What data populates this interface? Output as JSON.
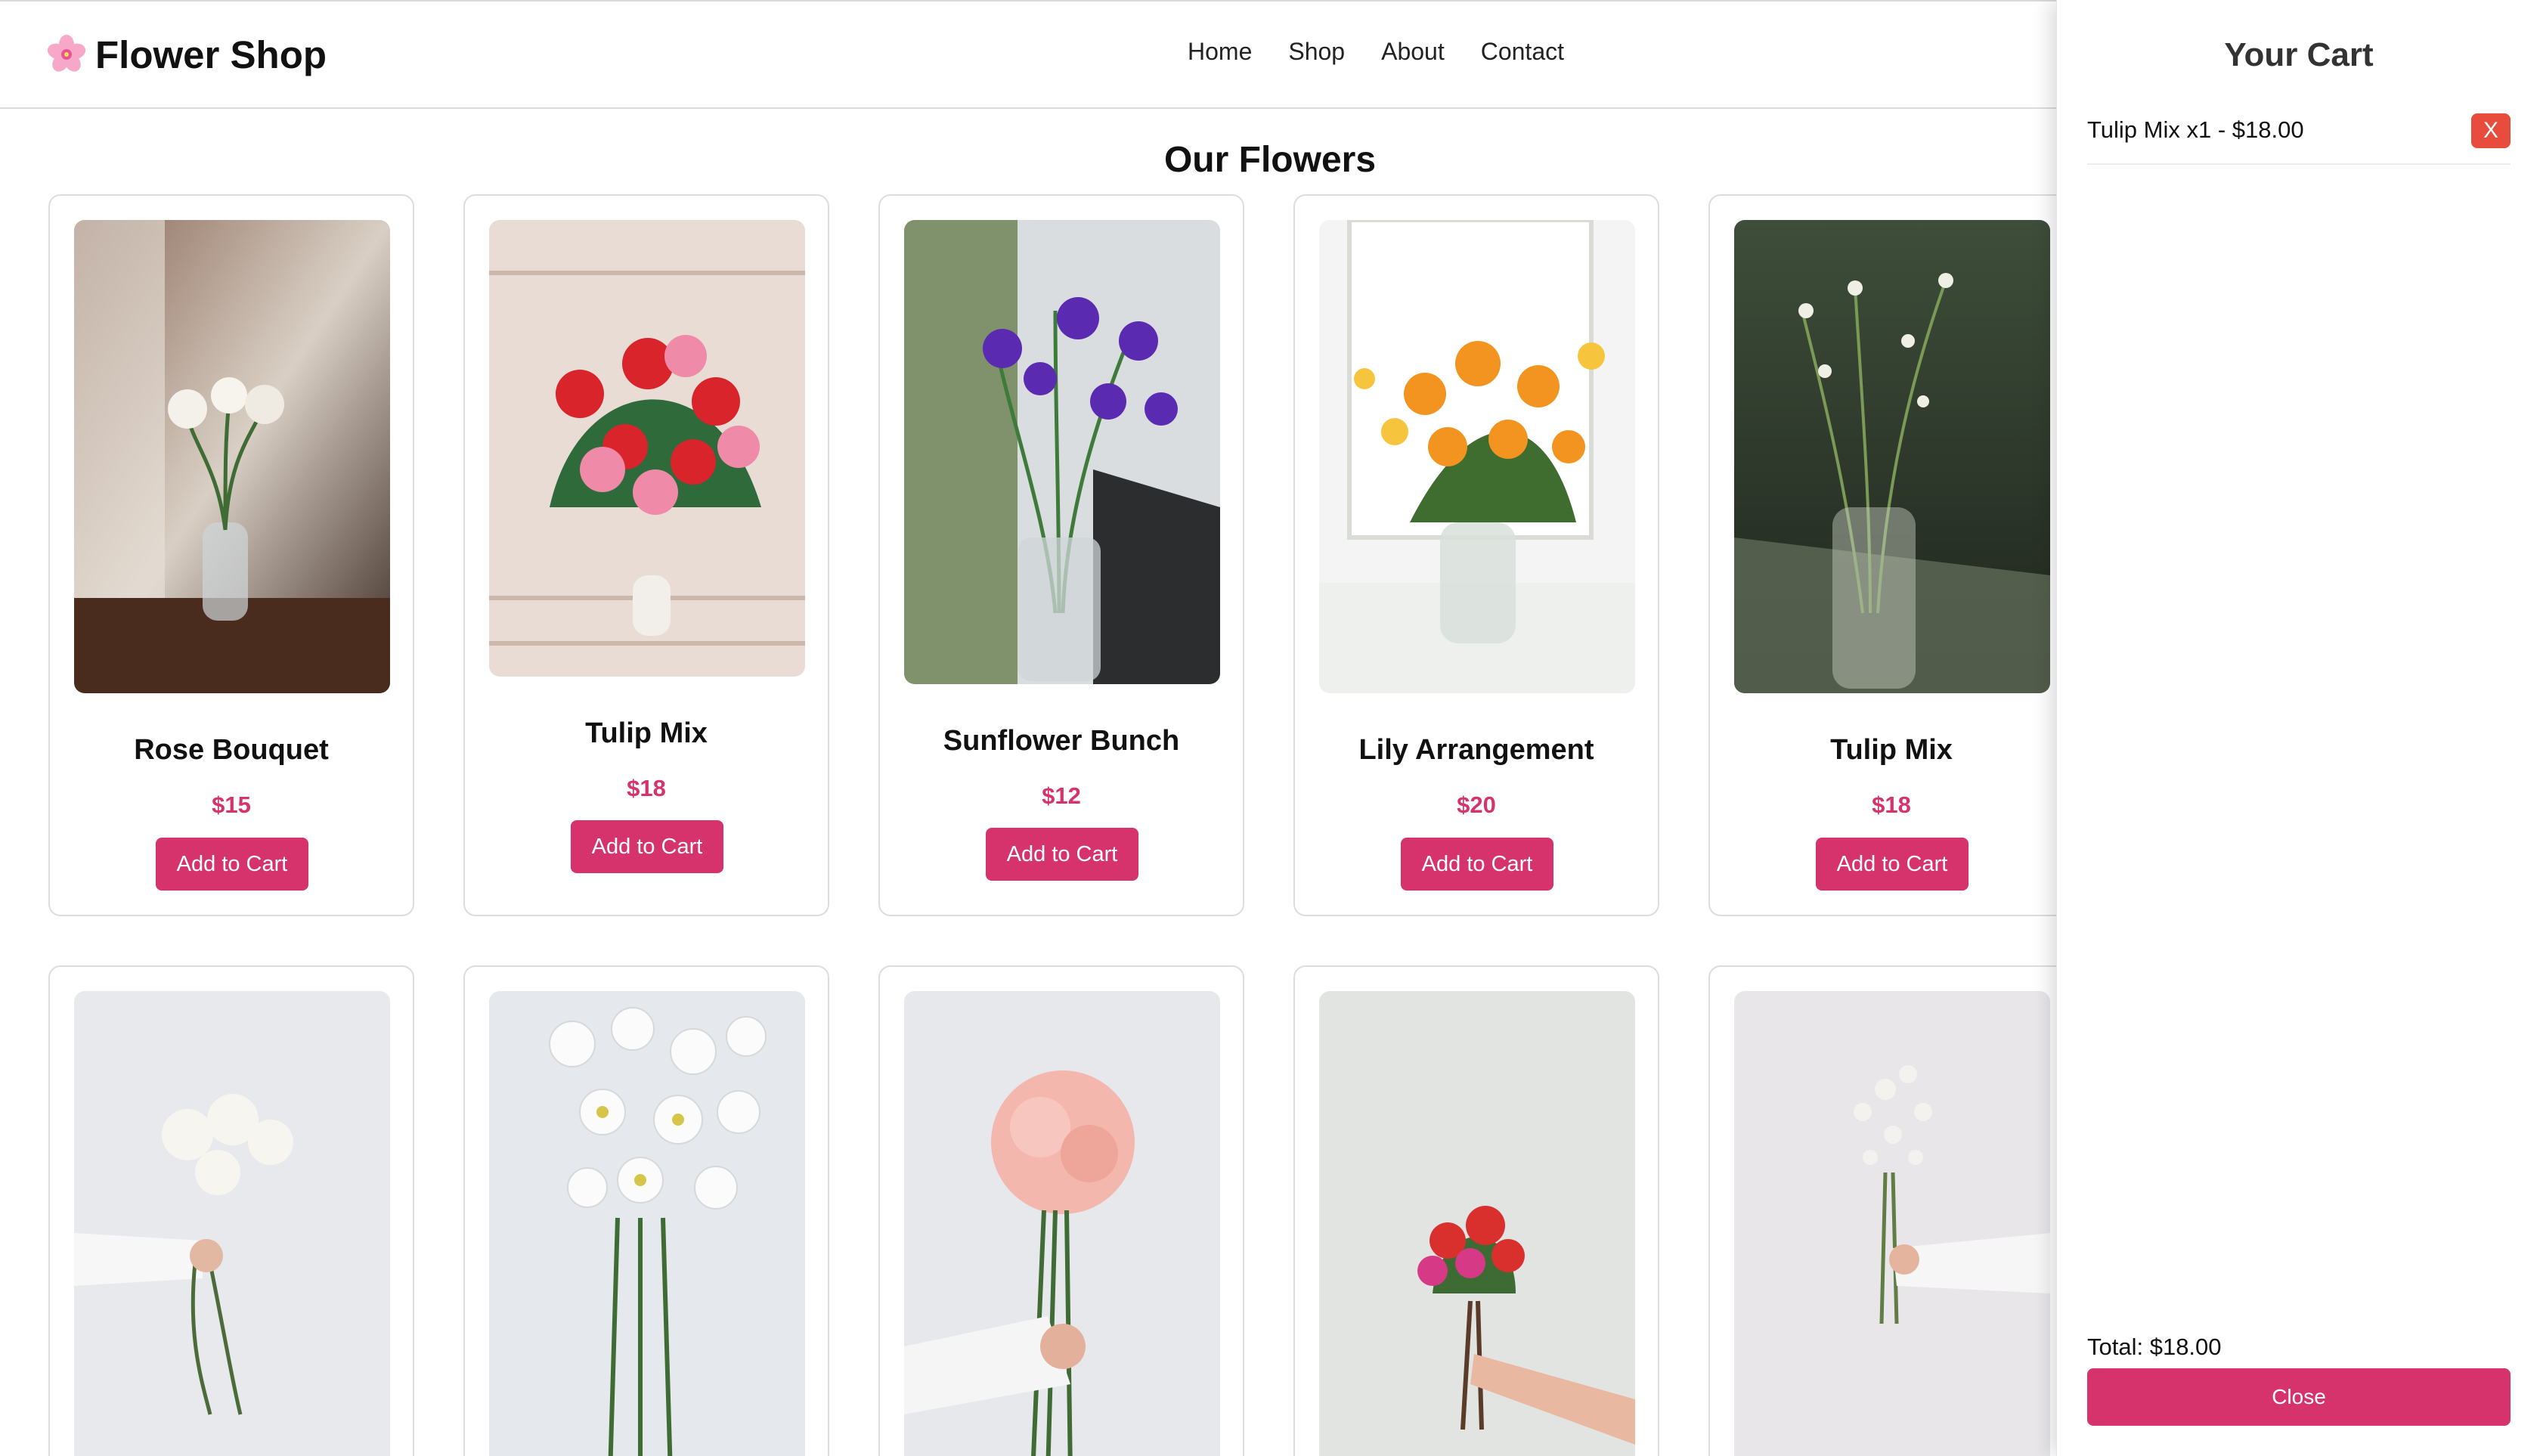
{
  "brand": {
    "name": "Flower Shop",
    "icon": "cherry-blossom-icon"
  },
  "nav": {
    "items": [
      "Home",
      "Shop",
      "About",
      "Contact"
    ]
  },
  "main": {
    "title": "Our Flowers"
  },
  "products": [
    {
      "name": "Rose Bouquet",
      "price": "$15",
      "button": "Add to Cart"
    },
    {
      "name": "Tulip Mix",
      "price": "$18",
      "button": "Add to Cart"
    },
    {
      "name": "Sunflower Bunch",
      "price": "$12",
      "button": "Add to Cart"
    },
    {
      "name": "Lily Arrangement",
      "price": "$20",
      "button": "Add to Cart"
    },
    {
      "name": "Tulip Mix",
      "price": "$18",
      "button": "Add to Cart"
    }
  ],
  "cart": {
    "title": "Your Cart",
    "items": [
      {
        "label": "Tulip Mix x1 - $18.00",
        "remove_label": "X"
      }
    ],
    "total": "Total: $18.00",
    "close_label": "Close"
  },
  "colors": {
    "accent": "#d6336c",
    "remove": "#e74c3c",
    "border": "#dddddd"
  }
}
